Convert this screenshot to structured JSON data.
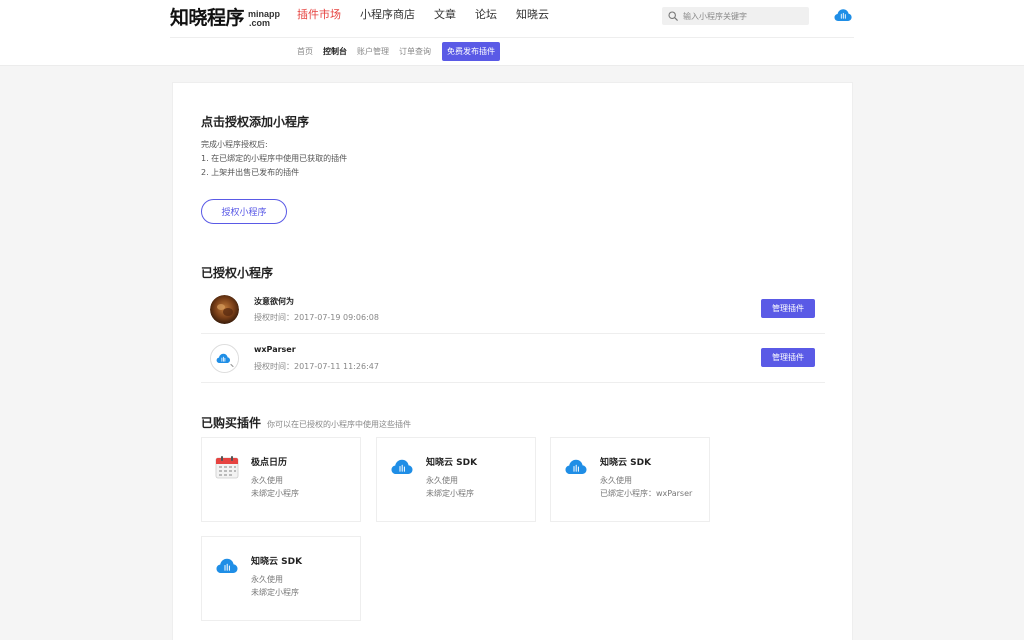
{
  "brand": {
    "cn": "知晓程序",
    "en_top": "minapp",
    "en_bottom": ".com"
  },
  "nav": [
    {
      "label": "插件市场",
      "active": true
    },
    {
      "label": "小程序商店",
      "active": false
    },
    {
      "label": "文章",
      "active": false
    },
    {
      "label": "论坛",
      "active": false
    },
    {
      "label": "知晓云",
      "active": false
    }
  ],
  "search": {
    "placeholder": "输入小程序关键字",
    "icon": "search-icon"
  },
  "header_icon": "cloud-icon",
  "subnav": {
    "items": [
      {
        "label": "首页",
        "active": false
      },
      {
        "label": "控制台",
        "active": true
      },
      {
        "label": "账户管理",
        "active": false
      },
      {
        "label": "订单查询",
        "active": false
      }
    ],
    "publish_label": "免费发布插件"
  },
  "colors": {
    "accent": "#5a5ae6",
    "nav_active": "#e64340",
    "cloud_blue": "#1f8ee6"
  },
  "authorize": {
    "title": "点击授权添加小程序",
    "intro": "完成小程序授权后:",
    "line1": "1. 在已绑定的小程序中使用已获取的插件",
    "line2": "2. 上架并出售已发布的插件",
    "button": "授权小程序"
  },
  "authorized": {
    "title": "已授权小程序",
    "apps": [
      {
        "name": "汝意欲何为",
        "time": "授权时间：2017-07-19 09:06:08",
        "action": "管理插件",
        "avatar": "brown-photo"
      },
      {
        "name": "wxParser",
        "time": "授权时间：2017-07-11 11:26:47",
        "action": "管理插件",
        "avatar": "cloud-logo"
      }
    ]
  },
  "purchased": {
    "title": "已购买插件",
    "note": "你可以在已授权的小程序中使用这些插件",
    "plugins": [
      {
        "name": "极点日历",
        "l1": "永久使用",
        "l2": "未绑定小程序",
        "icon": "calendar-icon"
      },
      {
        "name": "知晓云 SDK",
        "l1": "永久使用",
        "l2": "未绑定小程序",
        "icon": "cloud-icon"
      },
      {
        "name": "知晓云 SDK",
        "l1": "永久使用",
        "l2": "已绑定小程序：wxParser",
        "icon": "cloud-icon"
      },
      {
        "name": "知晓云 SDK",
        "l1": "永久使用",
        "l2": "未绑定小程序",
        "icon": "cloud-icon"
      }
    ]
  }
}
